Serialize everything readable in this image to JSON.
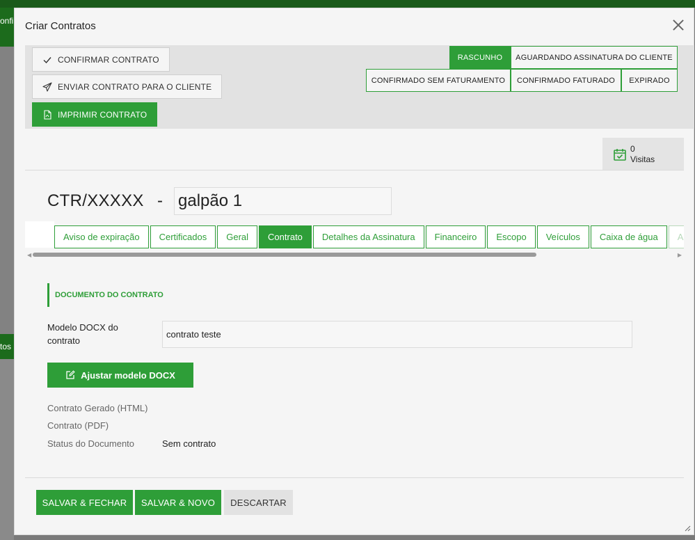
{
  "background": {
    "strip_top_text": "onfi",
    "strip_mid_text": "tos"
  },
  "modal": {
    "title": "Criar Contratos"
  },
  "toolbar": {
    "confirm_label": "CONFIRMAR CONTRATO",
    "send_label": "ENVIAR CONTRATO PARA O CLIENTE",
    "print_label": "IMPRIMIR CONTRATO"
  },
  "statuses": {
    "rascunho": "RASCUNHO",
    "aguardando": "AGUARDANDO ASSINATURA DO CLIENTE",
    "confirmado_sem": "CONFIRMADO SEM FATURAMENTO",
    "confirmado_fat": "CONFIRMADO FATURADO",
    "expirado": "EXPIRADO",
    "active": "RASCUNHO"
  },
  "visits": {
    "count": "0",
    "label": "Visitas"
  },
  "contract": {
    "code": "CTR/XXXXX",
    "separator": "-",
    "name": "galpão 1"
  },
  "tabs": [
    "Aviso de expiração",
    "Certificados",
    "Geral",
    "Contrato",
    "Detalhes da Assinatura",
    "Financeiro",
    "Escopo",
    "Veículos",
    "Caixa de água",
    "An"
  ],
  "active_tab": "Contrato",
  "section": {
    "title": "DOCUMENTO DO CONTRATO",
    "docx_label_line1": "Modelo DOCX do",
    "docx_label_line2": "contrato",
    "docx_value": "contrato teste",
    "adjust_button": "Ajustar modelo DOCX",
    "generated_html_label": "Contrato Gerado (HTML)",
    "pdf_label": "Contrato (PDF)",
    "status_label": "Status do Documento",
    "status_value": "Sem contrato"
  },
  "footer": {
    "save_close": "SALVAR & FECHAR",
    "save_new": "SALVAR & NOVO",
    "discard": "DESCARTAR"
  },
  "colors": {
    "accent": "#2e9e38",
    "overlay": "#7a7a7a"
  }
}
